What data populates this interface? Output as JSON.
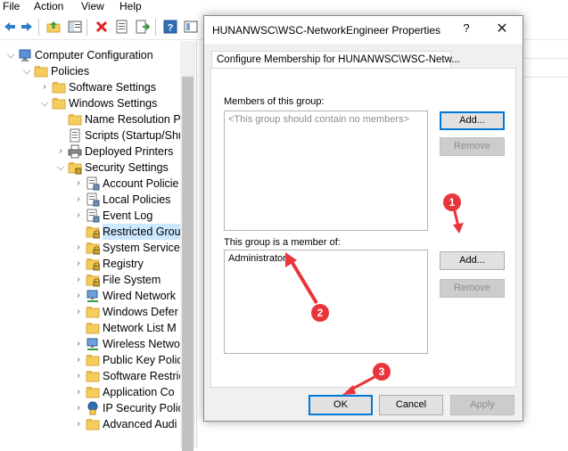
{
  "menubar": {
    "items": [
      "File",
      "Action",
      "View",
      "Help"
    ]
  },
  "toolbar": {
    "buttons": [
      "back-icon",
      "forward-icon",
      "up-folder-icon",
      "show-hide-tree-icon",
      "delete-icon",
      "properties-icon",
      "export-icon",
      "help-icon",
      "console-icon"
    ]
  },
  "tree": {
    "items": [
      {
        "label": "Computer Configuration",
        "icon": "computer-icon",
        "expander": "expanded"
      },
      {
        "label": "Policies",
        "icon": "folder-icon",
        "expander": "expanded"
      },
      {
        "label": "Software Settings",
        "icon": "folder-icon",
        "expander": "collapsed"
      },
      {
        "label": "Windows Settings",
        "icon": "folder-icon",
        "expander": "expanded"
      },
      {
        "label": "Name Resolution P",
        "icon": "folder-icon",
        "expander": "none"
      },
      {
        "label": "Scripts (Startup/Shu",
        "icon": "document-icon",
        "expander": "none"
      },
      {
        "label": "Deployed Printers",
        "icon": "printer-icon",
        "expander": "collapsed"
      },
      {
        "label": "Security Settings",
        "icon": "security-icon",
        "expander": "expanded"
      },
      {
        "label": "Account Policie",
        "icon": "policy-icon",
        "expander": "collapsed"
      },
      {
        "label": "Local Policies",
        "icon": "policy-icon",
        "expander": "collapsed"
      },
      {
        "label": "Event Log",
        "icon": "policy-icon",
        "expander": "collapsed"
      },
      {
        "label": "Restricted Grou",
        "icon": "locked-folder-icon",
        "expander": "none",
        "selected": true
      },
      {
        "label": "System Services",
        "icon": "locked-folder-icon",
        "expander": "collapsed"
      },
      {
        "label": "Registry",
        "icon": "locked-folder-icon",
        "expander": "collapsed"
      },
      {
        "label": "File System",
        "icon": "locked-folder-icon",
        "expander": "collapsed"
      },
      {
        "label": "Wired Network",
        "icon": "network-icon",
        "expander": "collapsed"
      },
      {
        "label": "Windows Defer",
        "icon": "folder-icon",
        "expander": "collapsed"
      },
      {
        "label": "Network List M",
        "icon": "folder-icon",
        "expander": "none"
      },
      {
        "label": "Wireless Netwo",
        "icon": "network-icon",
        "expander": "collapsed"
      },
      {
        "label": "Public Key Polic",
        "icon": "folder-icon",
        "expander": "collapsed"
      },
      {
        "label": "Software Restric",
        "icon": "folder-icon",
        "expander": "collapsed"
      },
      {
        "label": "Application Co",
        "icon": "folder-icon",
        "expander": "collapsed"
      },
      {
        "label": "IP Security Polic",
        "icon": "ip-security-icon",
        "expander": "collapsed"
      },
      {
        "label": "Advanced Audi",
        "icon": "folder-icon",
        "expander": "collapsed"
      }
    ]
  },
  "dialog": {
    "title": "HUNANWSC\\WSC-NetworkEngineer Properties",
    "help_glyph": "?",
    "close_glyph": "✕",
    "tab_label": "Configure Membership for HUNANWSC\\WSC-Netw...",
    "members": {
      "label": "Members of this group:",
      "placeholder": "<This group should contain no members>",
      "add_label": "Add...",
      "remove_label": "Remove"
    },
    "member_of": {
      "label": "This group is a member of:",
      "entries": [
        "Administrators"
      ],
      "add_label": "Add...",
      "remove_label": "Remove"
    },
    "ok_label": "OK",
    "cancel_label": "Cancel",
    "apply_label": "Apply"
  },
  "annotations": {
    "color": "#e8353b",
    "markers": [
      "1",
      "2",
      "3"
    ]
  }
}
